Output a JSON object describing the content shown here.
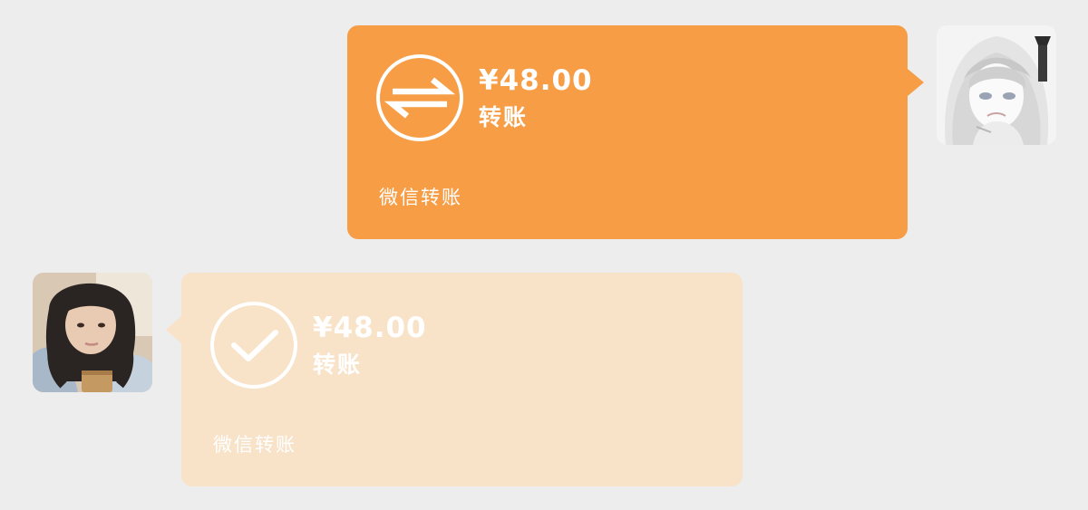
{
  "colors": {
    "background": "#ededed",
    "sent_bubble": "#f69d45",
    "received_bubble": "#f8e3c9",
    "text": "#ffffff"
  },
  "messages": [
    {
      "direction": "outgoing",
      "status": "pending",
      "icon": "transfer-arrows-icon",
      "amount": "¥48.00",
      "title": "转账",
      "footer": "微信转账"
    },
    {
      "direction": "incoming",
      "status": "received",
      "icon": "checkmark-circle-icon",
      "amount": "¥48.00",
      "title": "转账",
      "footer": "微信转账"
    }
  ]
}
